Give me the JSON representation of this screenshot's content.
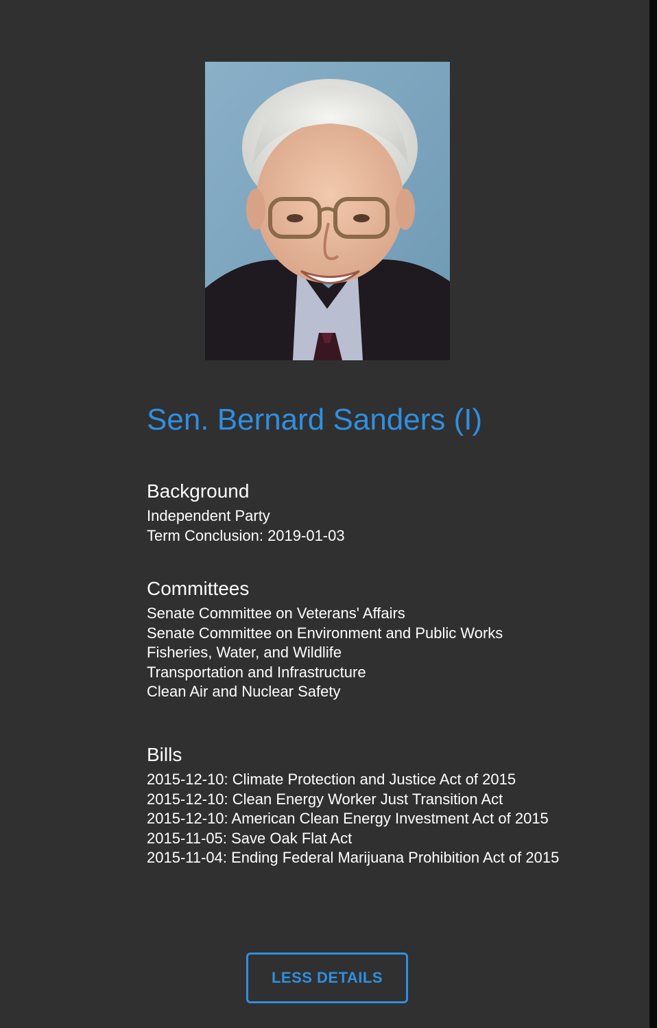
{
  "senator": {
    "name": "Sen. Bernard Sanders (I)"
  },
  "background": {
    "heading": "Background",
    "lines": [
      "Independent Party",
      "Term Conclusion: 2019-01-03"
    ]
  },
  "committees": {
    "heading": "Committees",
    "items": [
      "Senate Committee on Veterans' Affairs",
      "Senate Committee on Environment and Public Works",
      "Fisheries, Water, and Wildlife",
      "Transportation and Infrastructure",
      "Clean Air and Nuclear Safety"
    ]
  },
  "bills": {
    "heading": "Bills",
    "items": [
      "2015-12-10: Climate Protection and Justice Act of 2015",
      "2015-12-10: Clean Energy Worker Just Transition Act",
      "2015-12-10: American Clean Energy Investment Act of 2015",
      "2015-11-05: Save Oak Flat Act",
      "2015-11-04: Ending Federal Marijuana Prohibition Act of 2015"
    ]
  },
  "actions": {
    "less_details_label": "LESS DETAILS"
  },
  "colors": {
    "background": "#303030",
    "accent": "#2f8fe0",
    "text": "#ffffff"
  }
}
